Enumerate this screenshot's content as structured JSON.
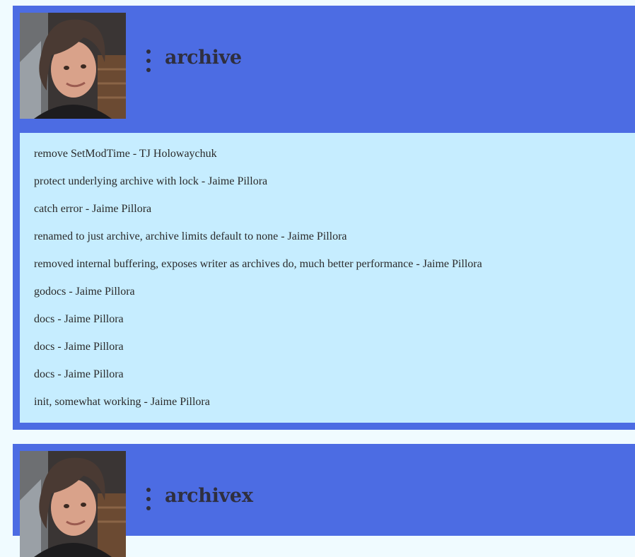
{
  "repos": [
    {
      "name": "archive",
      "commits": [
        "remove SetModTime - TJ Holowaychuk",
        "protect underlying archive with lock - Jaime Pillora",
        "catch error - Jaime Pillora",
        "renamed to just archive, archive limits default to none - Jaime Pillora",
        "removed internal buffering, exposes writer as archives do, much better performance - Jaime Pillora",
        "godocs - Jaime Pillora",
        "docs - Jaime Pillora",
        "docs - Jaime Pillora",
        "docs - Jaime Pillora",
        "init, somewhat working - Jaime Pillora"
      ]
    },
    {
      "name": "archivex",
      "commits": []
    }
  ],
  "icons": {
    "menu": "kebab-menu-icon",
    "avatar": "avatar-image"
  },
  "colors": {
    "page_background": "#f0fbff",
    "card_header": "#4c6ce3",
    "commit_panel": "#c6edff",
    "title_text": "#2f2f3f"
  }
}
